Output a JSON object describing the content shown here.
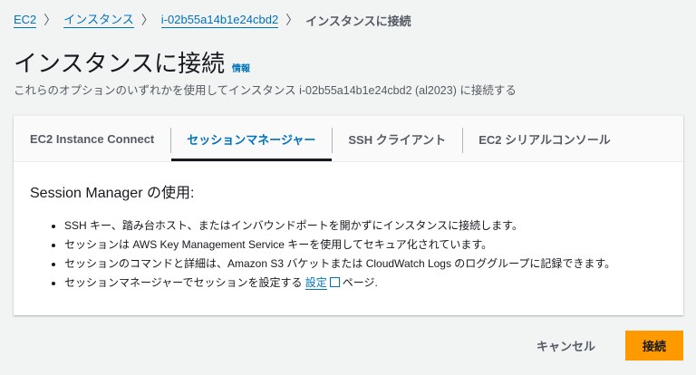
{
  "breadcrumb": [
    "EC2",
    "インスタンス",
    "i-02b55a14b1e24cbd2",
    "インスタンスに接続"
  ],
  "title": "インスタンスに接続",
  "info_link": "情報",
  "subtitle": "これらのオプションのいずれかを使用してインスタンス i-02b55a14b1e24cbd2 (al2023) に接続する",
  "tabs": [
    {
      "label": "EC2 Instance Connect"
    },
    {
      "label": "セッションマネージャー",
      "active": true
    },
    {
      "label": "SSH クライアント"
    },
    {
      "label": "EC2 シリアルコンソール"
    }
  ],
  "panel": {
    "heading": "Session Manager の使用:",
    "bullets": [
      "SSH キー、踏み台ホスト、またはインバウンドポートを開かずにインスタンスに接続します。",
      "セッションは AWS Key Management Service キーを使用してセキュア化されています。",
      "セッションのコマンドと詳細は、Amazon S3 バケットまたは CloudWatch Logs のロググループに記録できます。"
    ],
    "last_bullet_prefix": "セッションマネージャーでセッションを設定する ",
    "last_bullet_link": "設定",
    "last_bullet_suffix": "ページ."
  },
  "buttons": {
    "cancel": "キャンセル",
    "connect": "接続"
  }
}
